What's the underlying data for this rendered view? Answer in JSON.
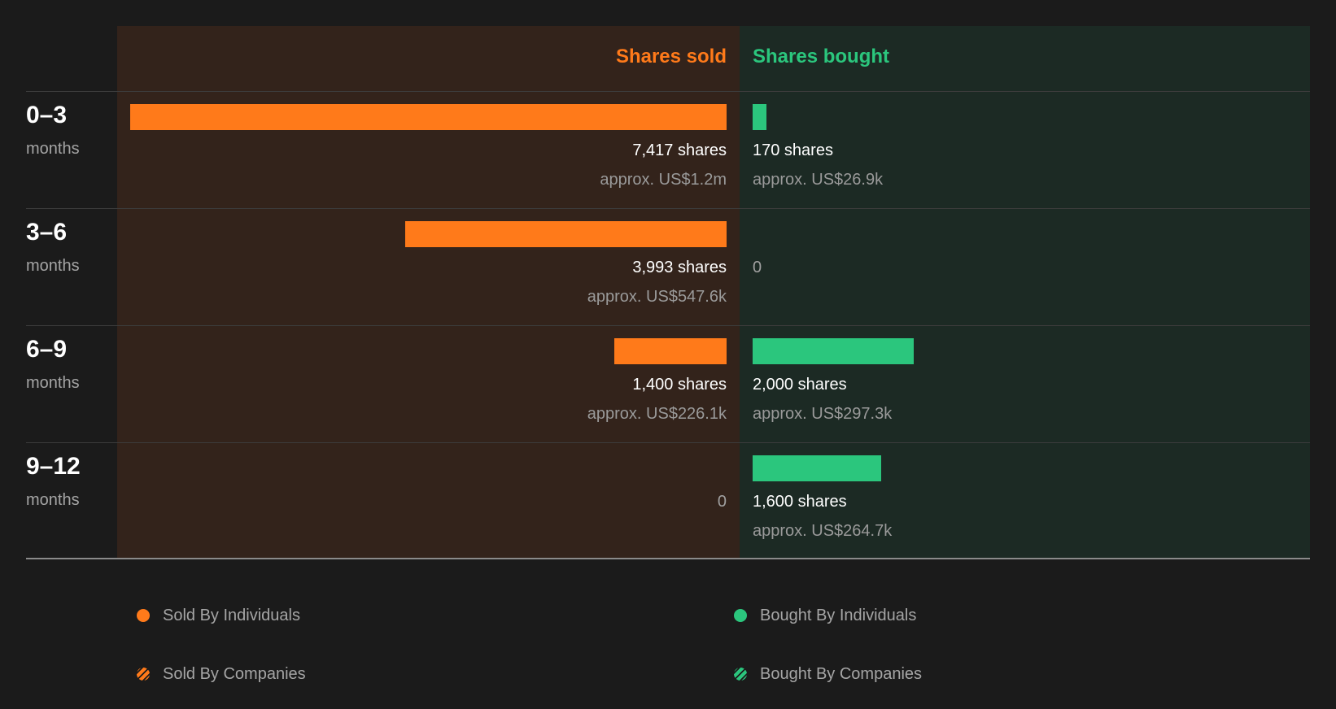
{
  "colors": {
    "sold": "#ff7a1a",
    "bought": "#2bc67d",
    "background": "#1b1b1b"
  },
  "headers": {
    "sold": "Shares sold",
    "bought": "Shares bought"
  },
  "chart_data": {
    "type": "bar",
    "categories": [
      "0-3 months",
      "3-6 months",
      "6-9 months",
      "9-12 months"
    ],
    "series": [
      {
        "name": "Shares sold",
        "values": [
          7417,
          3993,
          1400,
          0
        ]
      },
      {
        "name": "Shares bought",
        "values": [
          170,
          0,
          2000,
          1600
        ]
      }
    ]
  },
  "rows": [
    {
      "period": "0–3",
      "unit": "months",
      "sold": {
        "shares": 7417,
        "shares_text": "7,417 shares",
        "approx": "approx. US$1.2m"
      },
      "bought": {
        "shares": 170,
        "shares_text": "170 shares",
        "approx": "approx. US$26.9k"
      }
    },
    {
      "period": "3–6",
      "unit": "months",
      "sold": {
        "shares": 3993,
        "shares_text": "3,993 shares",
        "approx": "approx. US$547.6k"
      },
      "bought": {
        "shares": 0,
        "shares_text": "0",
        "approx": ""
      }
    },
    {
      "period": "6–9",
      "unit": "months",
      "sold": {
        "shares": 1400,
        "shares_text": "1,400 shares",
        "approx": "approx. US$226.1k"
      },
      "bought": {
        "shares": 2000,
        "shares_text": "2,000 shares",
        "approx": "approx. US$297.3k"
      }
    },
    {
      "period": "9–12",
      "unit": "months",
      "sold": {
        "shares": 0,
        "shares_text": "0",
        "approx": ""
      },
      "bought": {
        "shares": 1600,
        "shares_text": "1,600 shares",
        "approx": "approx. US$264.7k"
      }
    }
  ],
  "legend": {
    "sold_individuals": "Sold By Individuals",
    "bought_individuals": "Bought By Individuals",
    "sold_companies": "Sold By Companies",
    "bought_companies": "Bought By Companies"
  }
}
